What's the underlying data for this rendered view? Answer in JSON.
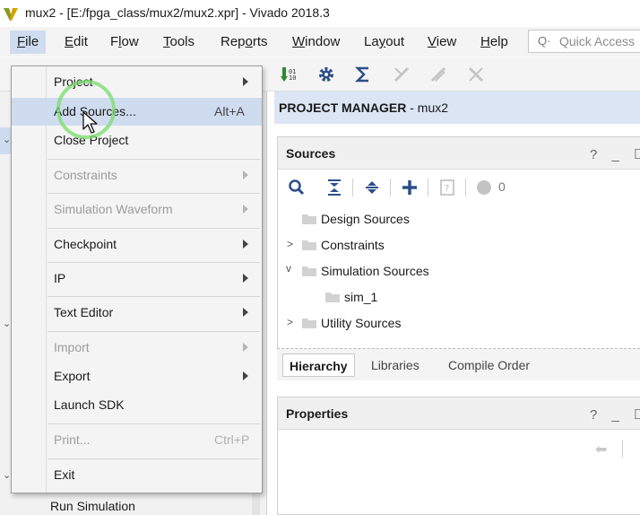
{
  "window": {
    "title": "mux2 - [E:/fpga_class/mux2/mux2.xpr] - Vivado 2018.3"
  },
  "menubar": {
    "items": [
      {
        "key": "F",
        "rest": "ile"
      },
      {
        "key": "E",
        "rest": "dit"
      },
      {
        "pre": "F",
        "key": "l",
        "rest": "ow"
      },
      {
        "key": "T",
        "rest": "ools"
      },
      {
        "pre": "Rep",
        "key": "o",
        "rest": "rts"
      },
      {
        "key": "W",
        "rest": "indow"
      },
      {
        "pre": "La",
        "key": "y",
        "rest": "out"
      },
      {
        "key": "V",
        "rest": "iew"
      },
      {
        "key": "H",
        "rest": "elp"
      }
    ],
    "quick_access_placeholder": "Quick Access"
  },
  "file_menu": {
    "items": [
      {
        "label": "Project",
        "shortcut": "",
        "submenu": true,
        "enabled": true
      },
      {
        "label": "Add Sources...",
        "shortcut": "Alt+A",
        "submenu": false,
        "enabled": true,
        "highlighted": true
      },
      {
        "label": "Close Project",
        "shortcut": "",
        "submenu": false,
        "enabled": true
      },
      {
        "label": "Constraints",
        "shortcut": "",
        "submenu": true,
        "enabled": false
      },
      {
        "label": "Simulation Waveform",
        "shortcut": "",
        "submenu": true,
        "enabled": false
      },
      {
        "label": "Checkpoint",
        "shortcut": "",
        "submenu": true,
        "enabled": true
      },
      {
        "label": "IP",
        "shortcut": "",
        "submenu": true,
        "enabled": true
      },
      {
        "label": "Text Editor",
        "shortcut": "",
        "submenu": true,
        "enabled": true
      },
      {
        "label": "Import",
        "shortcut": "",
        "submenu": true,
        "enabled": false
      },
      {
        "label": "Export",
        "shortcut": "",
        "submenu": true,
        "enabled": true
      },
      {
        "label": "Launch SDK",
        "shortcut": "",
        "submenu": false,
        "enabled": true
      },
      {
        "label": "Print...",
        "shortcut": "Ctrl+P",
        "submenu": false,
        "enabled": false
      },
      {
        "label": "Exit",
        "shortcut": "",
        "submenu": false,
        "enabled": true
      }
    ]
  },
  "flow_navigator": {
    "run_simulation": "Run Simulation"
  },
  "project_manager": {
    "title_bold": "PROJECT MANAGER",
    "title_rest": " - mux2"
  },
  "sources": {
    "title": "Sources",
    "controls": "? _ ☐",
    "count": "0",
    "tree": [
      {
        "label": "Design Sources",
        "level": 0,
        "expander": "none"
      },
      {
        "label": "Constraints",
        "level": 0,
        "expander": "collapsed"
      },
      {
        "label": "Simulation Sources",
        "level": 0,
        "expander": "expanded"
      },
      {
        "label": "sim_1",
        "level": 1,
        "expander": "none"
      },
      {
        "label": "Utility Sources",
        "level": 0,
        "expander": "collapsed"
      }
    ],
    "tabs": [
      "Hierarchy",
      "Libraries",
      "Compile Order"
    ],
    "active_tab": "Hierarchy"
  },
  "properties": {
    "title": "Properties",
    "controls": "? _ ☐"
  },
  "colors": {
    "menu_highlight": "#cfdcef",
    "header_blue": "#dbe5f3",
    "click_ring": "#78dc6e"
  }
}
